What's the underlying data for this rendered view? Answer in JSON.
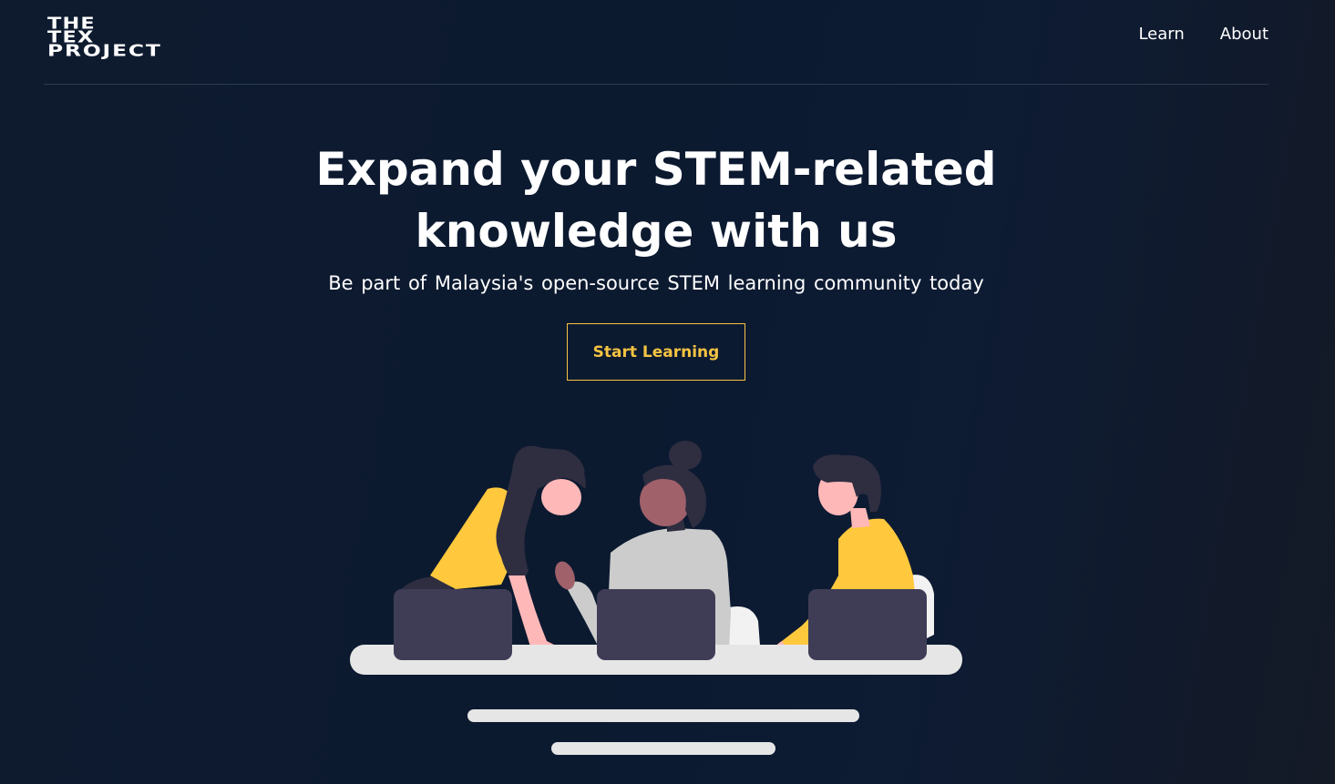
{
  "logo": {
    "line1": "THE",
    "line2": "TEX",
    "line3": "PROJECT"
  },
  "nav": {
    "items": [
      {
        "label": "Learn"
      },
      {
        "label": "About"
      }
    ]
  },
  "hero": {
    "title_line1": "Expand your STEM-related",
    "title_line2": "knowledge with us",
    "subtitle": "Be part of Malaysia's open-source STEM learning community today",
    "cta_label": "Start Learning"
  },
  "colors": {
    "background": "#0e1b2f",
    "accent": "#f5c342",
    "text": "#ffffff",
    "laptop": "#3f3d56",
    "desk": "#e6e6e6",
    "skin": "#ffb8b8",
    "skin_dark": "#a0616a",
    "hair": "#2f2e41",
    "shirt_yellow": "#ffc83d",
    "shirt_gray": "#cccccc"
  },
  "illustration": {
    "icon": "people-studying-laptops-illustration"
  }
}
